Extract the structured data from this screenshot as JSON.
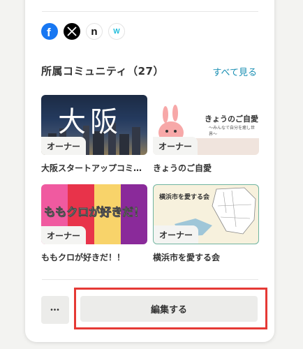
{
  "social": {
    "icons": [
      "facebook-icon",
      "x-icon",
      "note-icon",
      "wantedly-icon"
    ],
    "note_glyph": "n",
    "wantedly_glyph": "W"
  },
  "section": {
    "title": "所属コミュニティ（27）",
    "see_all": "すべて見る"
  },
  "communities": [
    {
      "name": "大阪スタートアップコミ…",
      "badge": "オーナー",
      "thumb_text": "大阪"
    },
    {
      "name": "きょうのご自愛",
      "badge": "オーナー",
      "thumb_title": "きょうのご自愛",
      "thumb_sub": "〜みんなで自分を癒し世界〜"
    },
    {
      "name": "ももクロが好きだ！！",
      "badge": "オーナー",
      "thumb_text": "ももクロが好きだ！"
    },
    {
      "name": "横浜市を愛する会",
      "badge": "オーナー",
      "thumb_text": "横浜市を愛する会"
    }
  ],
  "actions": {
    "more": "•••",
    "edit": "編集する"
  },
  "colors": {
    "accent_link": "#1a8fb3",
    "highlight": "#e53935",
    "facebook": "#1877f2"
  }
}
